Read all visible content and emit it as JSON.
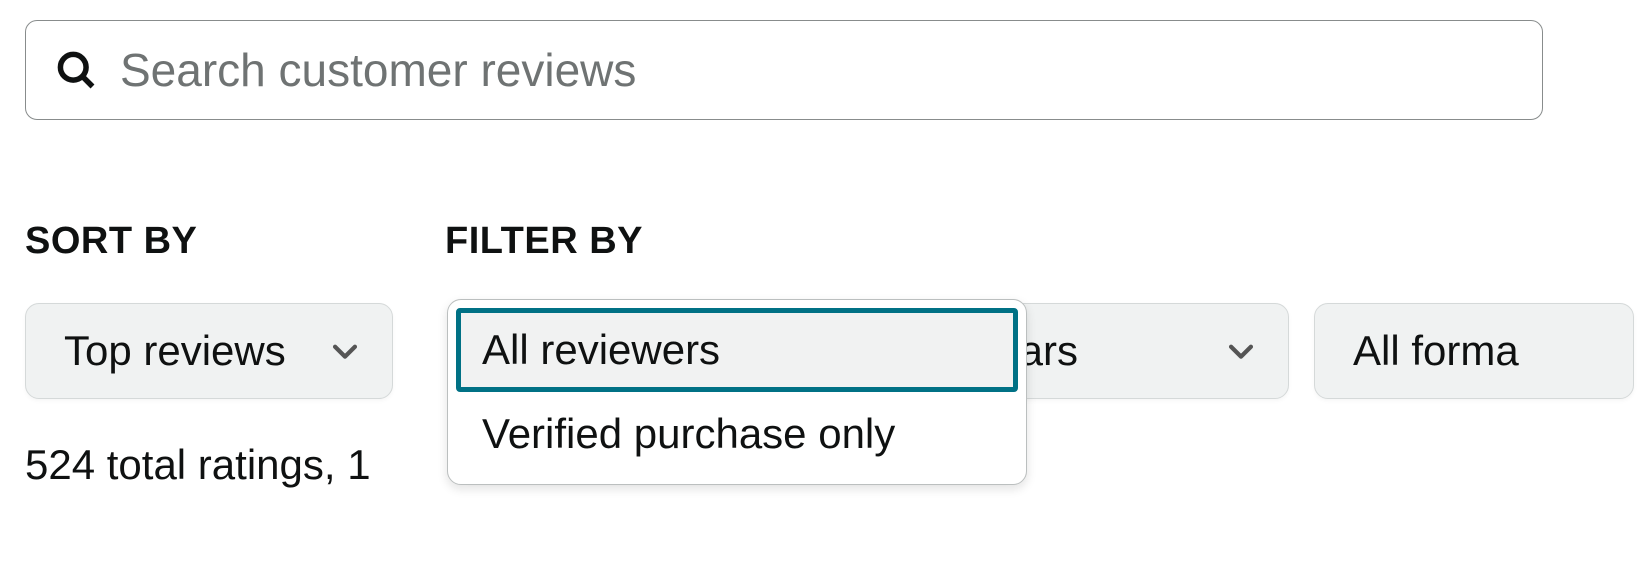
{
  "search": {
    "placeholder": "Search customer reviews",
    "value": ""
  },
  "labels": {
    "sort_by": "SORT BY",
    "filter_by": "FILTER BY"
  },
  "sort": {
    "selected": "Top reviews"
  },
  "filters": {
    "reviewers": {
      "selected": "All reviewers",
      "options": [
        "All reviewers",
        "Verified purchase only"
      ]
    },
    "stars": {
      "visible_text": "tars"
    },
    "formats": {
      "visible_text": "All forma"
    }
  },
  "status": {
    "visible_text": "524 total ratings, 1"
  },
  "colors": {
    "accent": "#007185",
    "border": "#888c8c",
    "dropdown_bg": "#f0f2f2",
    "dropdown_border": "#d5d9d9",
    "text": "#0f1111",
    "placeholder": "#6f7373"
  }
}
